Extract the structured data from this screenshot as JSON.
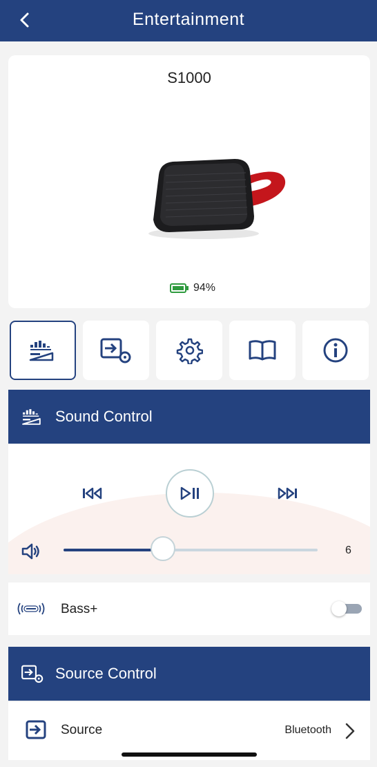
{
  "header": {
    "title": "Entertainment",
    "back_icon": "back-chevron-icon"
  },
  "device": {
    "name": "S1000",
    "battery": "94%",
    "battery_color": "#2e9a3e"
  },
  "tabs": [
    {
      "name": "equalizer",
      "icon": "equalizer-icon",
      "active": true
    },
    {
      "name": "source-settings",
      "icon": "source-settings-icon",
      "active": false
    },
    {
      "name": "settings",
      "icon": "gear-icon",
      "active": false
    },
    {
      "name": "manual",
      "icon": "book-icon",
      "active": false
    },
    {
      "name": "info",
      "icon": "info-icon",
      "active": false
    }
  ],
  "sound_control": {
    "title": "Sound Control",
    "icon": "equalizer-icon",
    "volume": {
      "value": "6",
      "level": 0.39
    }
  },
  "bass": {
    "label": "Bass+",
    "icon": "bass-icon",
    "enabled": false
  },
  "source_control": {
    "title": "Source Control",
    "icon": "source-settings-icon"
  },
  "source": {
    "label": "Source",
    "value": "Bluetooth",
    "icon": "input-icon"
  },
  "colors": {
    "primary": "#24427f",
    "accent_red": "#d61f26"
  }
}
